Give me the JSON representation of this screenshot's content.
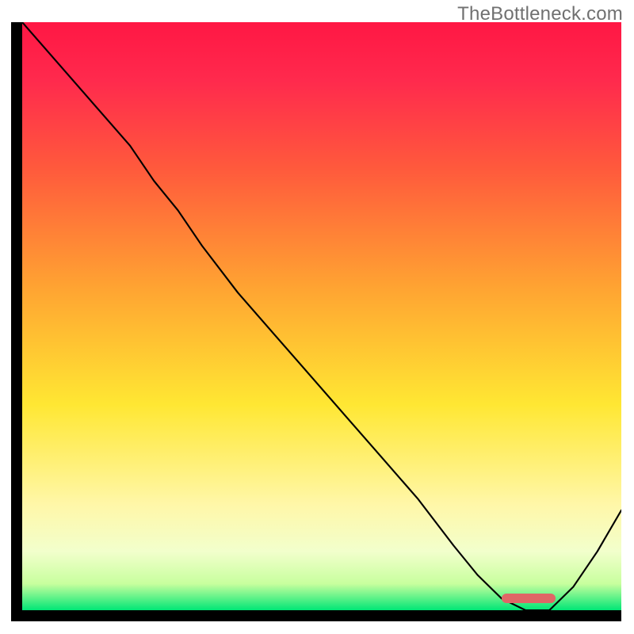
{
  "watermark": "TheBottleneck.com",
  "chart_data": {
    "type": "line",
    "title": "",
    "xlabel": "",
    "ylabel": "",
    "background_gradient_stops": [
      {
        "offset": 0.0,
        "color": "#ff1744"
      },
      {
        "offset": 0.1,
        "color": "#ff2a4d"
      },
      {
        "offset": 0.25,
        "color": "#ff5a3c"
      },
      {
        "offset": 0.45,
        "color": "#ffa332"
      },
      {
        "offset": 0.65,
        "color": "#ffe733"
      },
      {
        "offset": 0.82,
        "color": "#fff7a8"
      },
      {
        "offset": 0.9,
        "color": "#f2ffcc"
      },
      {
        "offset": 0.955,
        "color": "#c8ff9e"
      },
      {
        "offset": 1.0,
        "color": "#00e676"
      }
    ],
    "xlim": [
      0,
      100
    ],
    "ylim": [
      0,
      100
    ],
    "series": [
      {
        "name": "bottleneck-curve",
        "color": "#000000",
        "stroke_width": 2.2,
        "x": [
          0,
          6,
          12,
          18,
          22,
          26,
          30,
          36,
          42,
          48,
          54,
          60,
          66,
          72,
          76,
          80,
          84,
          88,
          92,
          96,
          100
        ],
        "y": [
          100,
          93,
          86,
          79,
          73,
          68,
          62,
          54,
          47,
          40,
          33,
          26,
          19,
          11,
          6,
          2,
          0,
          0,
          4,
          10,
          17
        ]
      }
    ],
    "marker": {
      "name": "optimal-range-pill",
      "color": "#e06666",
      "x_start": 80,
      "x_end": 89,
      "y": 1.2,
      "height_pct": 1.6
    }
  }
}
